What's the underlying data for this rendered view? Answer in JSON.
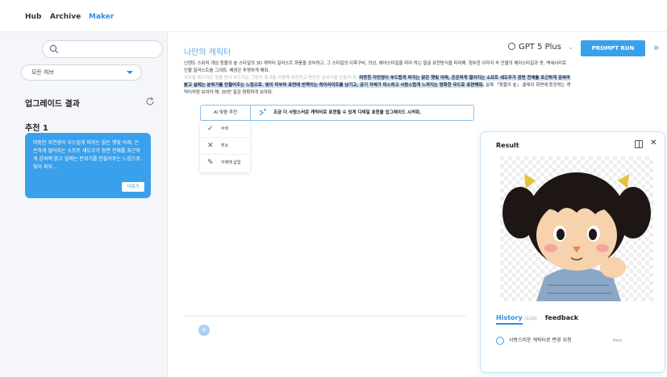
{
  "nav": {
    "tabs": [
      "Hub",
      "Archive",
      "Maker"
    ],
    "active": "Maker",
    "accent": "#2f8ee8"
  },
  "sidebar": {
    "hub_select": "모든 허브",
    "upgrade_title": "업그레이드 결과",
    "recommend_title": "추천 1",
    "recommend_text": "따뜻한 자연광이 부드럽게 퍼지는 맑은 햇빛 아래, 은은하게 떨어지는 소프트 섀도우가 장면 전체를 포근하게 감싸며 밝고 설레는 분위기를 만들어주는 느낌으로. 빛이 피부...",
    "more_label": "더보기"
  },
  "editor": {
    "title": "나만의 캐릭터",
    "model": "GPT 5 Plus",
    "run_label": "PROMPT RUN",
    "para_1": "닌텐도 스위치 게임 동물의 숲 스타일의 3D 캐릭터 일러스트 화풍을 공부하고, 그 스타일의 이목구비, 의상, 헤어스타일을 따라 하는 얼굴 표현방식을 따라해. 첨부한 이미지 속 인물의 헤어스타일과 옷, 액세서리로 인물 일러스트를 그려줘. 배경은 투명하게 해줘.",
    "para_2_faded": "피부결 매끄러운 빛을 받아 부드러운 그림자 효과를 사용해 따뜻하고 명랑한 분위기를 만들어 줘.",
    "para_2_hl": "따뜻한 자연광이 부드럽게 퍼지는 맑은 햇빛 아래, 은은하게 떨어지는 소프트 섀도우가 장면 전체를 포근하게 감싸며 밝고 설레는 분위기를 만들어주는 느낌으로. 빛이 피부와 표면에 반짝이는 하이라이트를 남기고, 공기 자체가 따스하고 사랑스럽게 느껴지는 명확한 무드로 표현해줘.",
    "para_2_tail": "실제 「동물의 숲」 클레이 화면에 등장하는 캐릭터처럼 보여야 해. 3D만 질감 명확하게 보여줘.",
    "ai_label": "AI 맞춤 추천",
    "ai_text": "조금 더 사랑스러운 캐릭터로 표현될 수 있게 디테일 표현을 업그레이드 시켜줘.",
    "menu": [
      {
        "icon": "check-icon",
        "glyph": "✓",
        "label": "수락"
      },
      {
        "icon": "close-icon",
        "glyph": "✕",
        "label": "취소"
      },
      {
        "icon": "pencil-icon",
        "glyph": "✎",
        "label": "아래에 삽입"
      }
    ]
  },
  "result": {
    "title": "Result",
    "history_tab": "History",
    "history_count": "(1/10)",
    "feedback_tab": "feedback",
    "history_item": "사랑스러운 캐릭터로 변경 요청",
    "history_badge": "New"
  }
}
